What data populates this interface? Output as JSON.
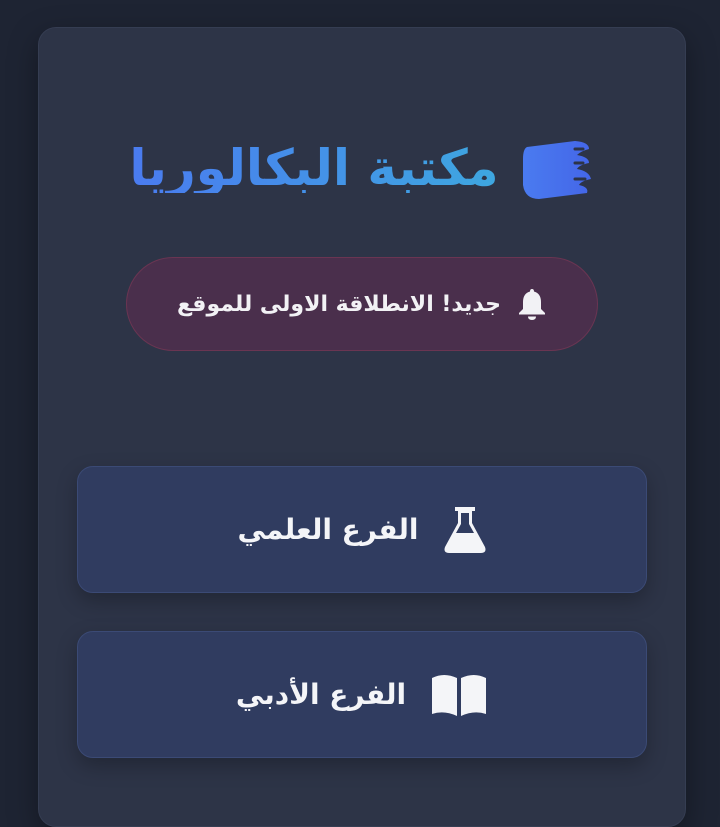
{
  "header": {
    "title": "مكتبة البكالوريا",
    "icon": "book-icon",
    "title_gradient": [
      "#4a7bf0",
      "#3ea7e0"
    ]
  },
  "notice": {
    "text": "جديد! الانطلاقة الاولى للموقع",
    "icon": "bell-icon"
  },
  "branches": [
    {
      "label": "الفرع العلمي",
      "icon": "flask-icon"
    },
    {
      "label": "الفرع الأدبي",
      "icon": "open-book-icon"
    }
  ],
  "colors": {
    "background": "#1e2433",
    "card": "#2d3447",
    "notice_bg": "#4a2f4c",
    "button_bg": "#303c60"
  }
}
